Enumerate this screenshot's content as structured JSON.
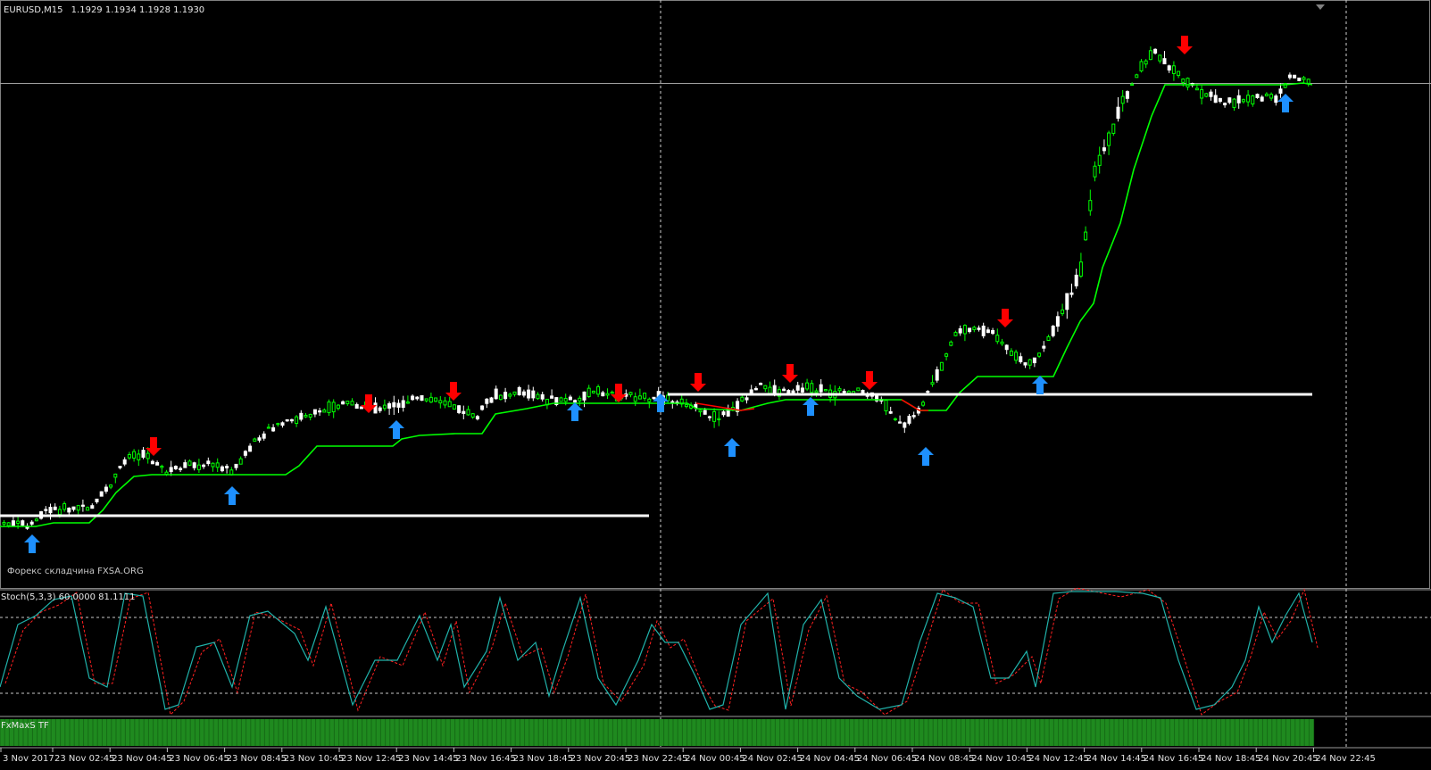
{
  "header": {
    "symbol": "EURUSD,M15",
    "ohlc": "1.1929 1.1934 1.1928 1.1930"
  },
  "watermark": "Форекс складчина FXSA.ORG",
  "stochastic": {
    "label": "Stoch(5,3,3) 60.0000 81.1111",
    "main_color": "#20b2aa",
    "signal_color": "#ff2020"
  },
  "fxmaxs": {
    "label": "FxMaxS TF",
    "bar_color": "#1f8a1f"
  },
  "time_axis": [
    "3 Nov 2017",
    "23 Nov 02:45",
    "23 Nov 04:45",
    "23 Nov 06:45",
    "23 Nov 08:45",
    "23 Nov 10:45",
    "23 Nov 12:45",
    "23 Nov 14:45",
    "23 Nov 16:45",
    "23 Nov 18:45",
    "23 Nov 20:45",
    "23 Nov 22:45",
    "24 Nov 00:45",
    "24 Nov 02:45",
    "24 Nov 04:45",
    "24 Nov 06:45",
    "24 Nov 08:45",
    "24 Nov 10:45",
    "24 Nov 12:45",
    "24 Nov 14:45",
    "24 Nov 16:45",
    "24 Nov 18:45",
    "24 Nov 20:45",
    "24 Nov 22:45"
  ],
  "colors": {
    "background": "#000000",
    "bull_candle": "#00ff00",
    "bear_candle": "#ffffff",
    "trend_line": "#00ff00",
    "trend_line_alt": "#ff0000",
    "buy_arrow": "#1e90ff",
    "sell_arrow": "#ff0000",
    "level_line": "#ffffff",
    "grid": "#c0c0c0"
  },
  "signals": {
    "buy_icon": "up-arrow-icon",
    "sell_icon": "down-arrow-icon"
  }
}
